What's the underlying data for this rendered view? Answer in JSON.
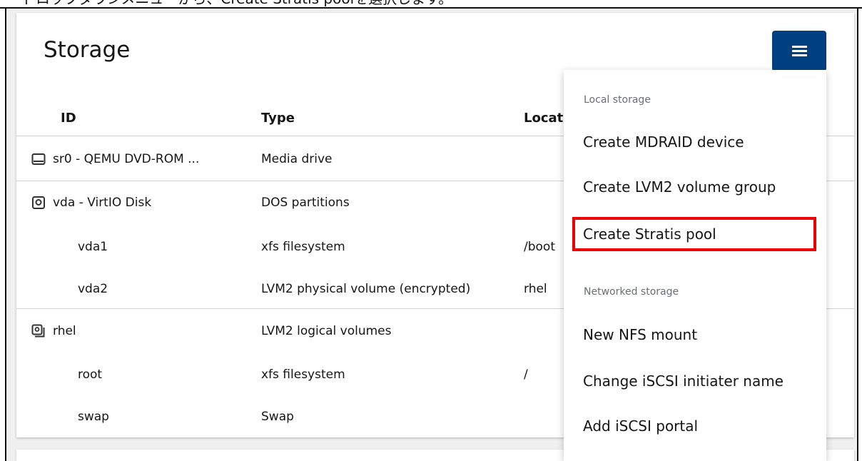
{
  "caption": {
    "text": "ドロップダウンメニューから、Create Stratis poolを選択します。"
  },
  "storage": {
    "title": "Storage",
    "menu_icon": "hamburger-menu-icon",
    "columns": [
      "ID",
      "Type",
      "Location"
    ],
    "rows": [
      {
        "id": "sr0 - QEMU DVD-ROM ...",
        "type": "Media drive",
        "location": "",
        "icon": "optical-drive-icon",
        "indent": false
      },
      {
        "id": "vda - VirtIO Disk",
        "type": "DOS partitions",
        "location": "",
        "icon": "disk-icon",
        "indent": false
      },
      {
        "id": "vda1",
        "type": "xfs filesystem",
        "location": "/boot",
        "icon": "",
        "indent": true
      },
      {
        "id": "vda2",
        "type": "LVM2 physical volume (encrypted)",
        "location": "rhel",
        "icon": "",
        "indent": true
      },
      {
        "id": "rhel",
        "type": "LVM2 logical volumes",
        "location": "",
        "icon": "volume-group-icon",
        "indent": false
      },
      {
        "id": "root",
        "type": "xfs filesystem",
        "location": "/",
        "icon": "",
        "indent": true
      },
      {
        "id": "swap",
        "type": "Swap",
        "location": "",
        "icon": "",
        "indent": true
      }
    ]
  },
  "dropdown": {
    "groups": [
      {
        "label": "Local storage",
        "items": [
          "Create MDRAID device",
          "Create LVM2 volume group",
          "Create Stratis pool"
        ]
      },
      {
        "label": "Networked storage",
        "items": [
          "New NFS mount",
          "Change iSCSI initiater name",
          "Add iSCSI portal"
        ]
      }
    ],
    "highlighted_item": "Create Stratis pool"
  },
  "colors": {
    "menu_button": "#004080",
    "highlight_border": "#ee0000",
    "page_background": "#f0f0f0"
  }
}
